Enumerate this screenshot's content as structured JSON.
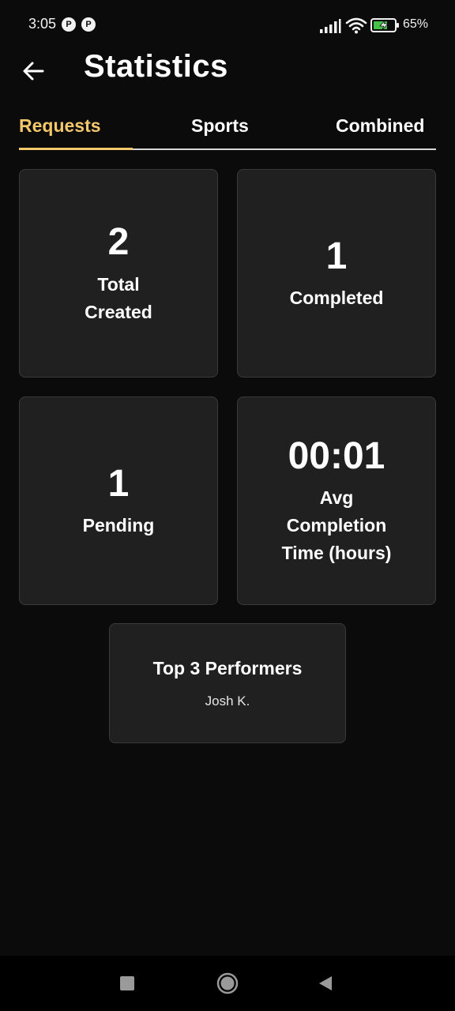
{
  "status_bar": {
    "time": "3:05",
    "notification_icons": [
      "app-notification-icon",
      "app-notification-icon"
    ],
    "signal_icon": "signal-bars-icon",
    "wifi_icon": "wifi-icon",
    "battery_icon": "battery-charging-icon",
    "battery_percent": "65%"
  },
  "app_bar": {
    "back_icon": "arrow-left-icon",
    "title": "Statistics"
  },
  "tabs": [
    {
      "label": "Requests",
      "active": true
    },
    {
      "label": "Sports",
      "active": false
    },
    {
      "label": "Combined",
      "active": false
    }
  ],
  "stats": {
    "total_created": {
      "value": "2",
      "label_line1": "Total",
      "label_line2": "Created"
    },
    "completed": {
      "value": "1",
      "label": "Completed"
    },
    "pending": {
      "value": "1",
      "label": "Pending"
    },
    "avg_completion": {
      "value": "00:01",
      "label_line1": "Avg",
      "label_line2": "Completion",
      "label_line3": "Time (hours)"
    }
  },
  "top_performers": {
    "title": "Top 3 Performers",
    "names": [
      "Josh K."
    ]
  },
  "nav_bar": {
    "recents_icon": "square-recents-icon",
    "home_icon": "circle-home-icon",
    "back_icon": "triangle-back-icon"
  },
  "colors": {
    "background": "#0b0b0b",
    "card_background": "#202020",
    "card_border": "#3a3a3a",
    "accent": "#f2c86b",
    "text": "#ffffff"
  }
}
